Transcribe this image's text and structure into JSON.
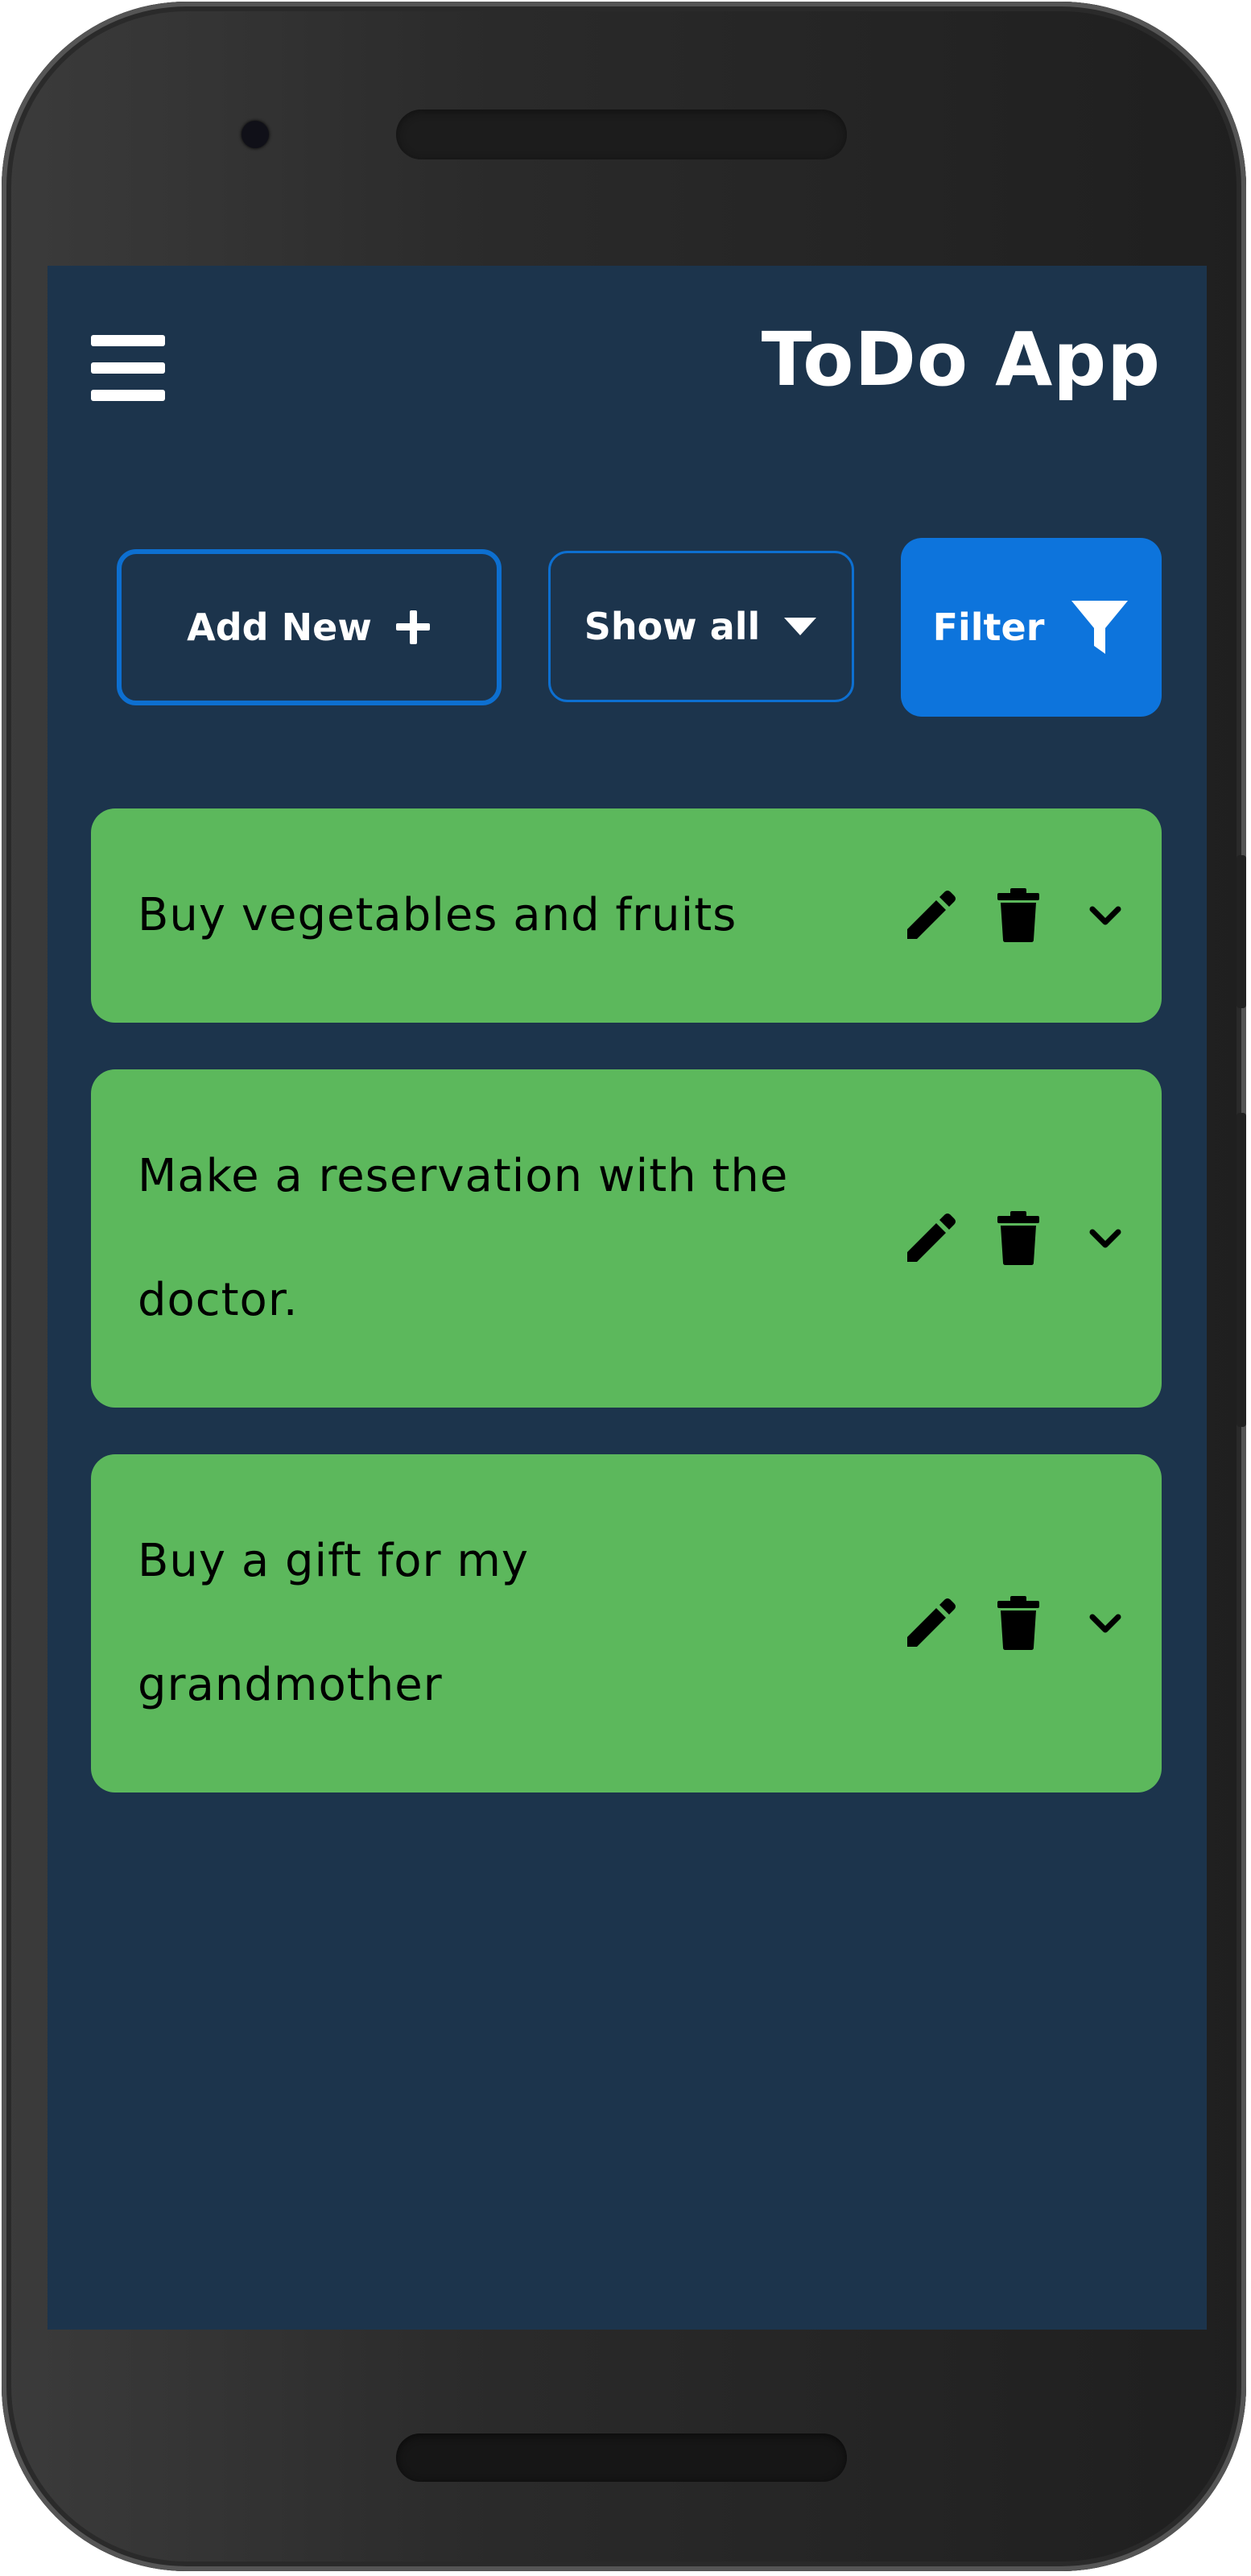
{
  "header": {
    "title": "ToDo App",
    "menu_icon": "hamburger-menu-icon"
  },
  "toolbar": {
    "add_label": "Add New",
    "add_icon": "plus-icon",
    "show_label": "Show all",
    "show_icon": "caret-down-icon",
    "filter_label": "Filter",
    "filter_icon": "filter-funnel-icon"
  },
  "todos": [
    {
      "text": "Buy vegetables and fruits"
    },
    {
      "text": "Make a reservation with the doctor."
    },
    {
      "text": "Buy a gift for my grandmother"
    }
  ],
  "item_actions": {
    "edit_icon": "pencil-icon",
    "delete_icon": "trash-icon",
    "expand_icon": "chevron-down-icon"
  },
  "colors": {
    "background": "#1c344c",
    "accent": "#0d74dc",
    "item": "#5cb85c",
    "text_light": "#ffffff",
    "text_dark": "#000000"
  }
}
